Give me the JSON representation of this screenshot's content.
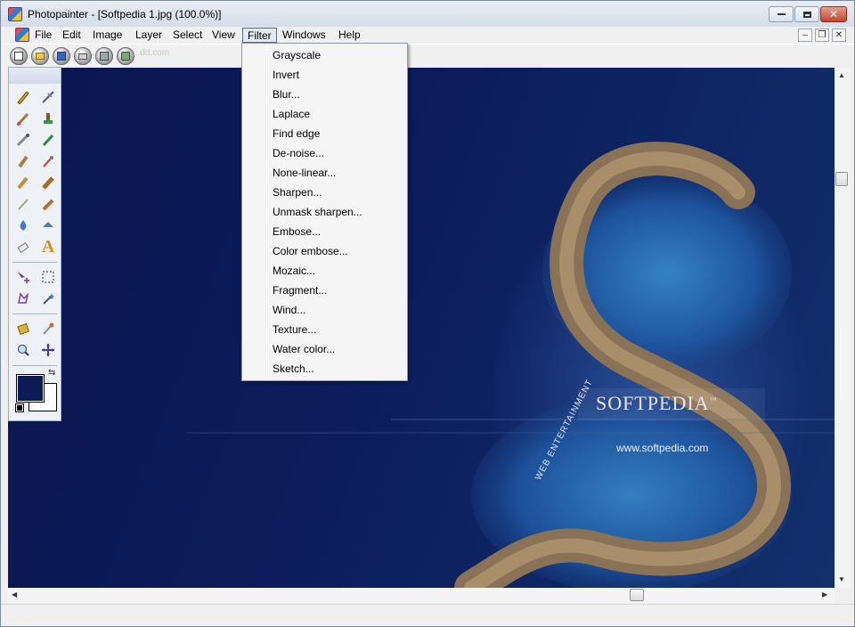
{
  "window": {
    "title": "Photopainter - [Softpedia 1.jpg  (100.0%)]",
    "caption_buttons": {
      "minimize": "minimize-icon",
      "maximize": "maximize-icon",
      "close": "✕"
    }
  },
  "menubar": {
    "items": [
      {
        "label": "File"
      },
      {
        "label": "Edit"
      },
      {
        "label": "Image"
      },
      {
        "label": "Layer"
      },
      {
        "label": "Select"
      },
      {
        "label": "View"
      },
      {
        "label": "Filter"
      },
      {
        "label": "Windows"
      },
      {
        "label": "Help"
      }
    ],
    "active": "Filter",
    "mdi_buttons": {
      "minimize": "–",
      "restore": "❐",
      "close": "✕"
    }
  },
  "toolbar": {
    "buttons": [
      "new-icon",
      "open-icon",
      "save-icon",
      "print-icon",
      "scan-icon",
      "camera-icon"
    ],
    "watermark": "...dd.com"
  },
  "filter_menu": {
    "items": [
      {
        "label": "Grayscale"
      },
      {
        "label": "Invert"
      },
      {
        "label": "Blur..."
      },
      {
        "label": "Laplace"
      },
      {
        "label": "Find edge"
      },
      {
        "label": "De-noise..."
      },
      {
        "label": "None-linear..."
      },
      {
        "label": "Sharpen..."
      },
      {
        "label": "Unmask sharpen..."
      },
      {
        "label": "Embose..."
      },
      {
        "label": "Color embose..."
      },
      {
        "label": "Mozaic..."
      },
      {
        "label": "Fragment..."
      },
      {
        "label": "Wind..."
      },
      {
        "label": "Texture..."
      },
      {
        "label": "Water color..."
      },
      {
        "label": "Sketch..."
      }
    ]
  },
  "canvas": {
    "brand": "SOFTPEDIA",
    "trademark": "™",
    "url": "www.softpedia.com",
    "tagline": "WEB ENTERTAINMENT"
  },
  "tools": [
    "pencil-icon",
    "line-icon",
    "brush-icon",
    "stamp-icon",
    "airbrush-icon",
    "pen-icon",
    "smudge-icon",
    "eyedropper-icon",
    "fill-icon",
    "bucket-icon",
    "magic-brush-icon",
    "burn-icon",
    "drop-icon",
    "sharpen-icon",
    "eraser-icon",
    "text-icon",
    "move-selection-icon",
    "rect-select-icon",
    "lasso-icon",
    "magic-wand-icon",
    "paint-bucket-icon",
    "color-picker-icon",
    "zoom-icon",
    "pan-icon"
  ],
  "text_tool_glyph": "A",
  "colors": {
    "foreground": "#0c1a55",
    "background": "#ffffff",
    "accent_close": "#c4432e"
  }
}
